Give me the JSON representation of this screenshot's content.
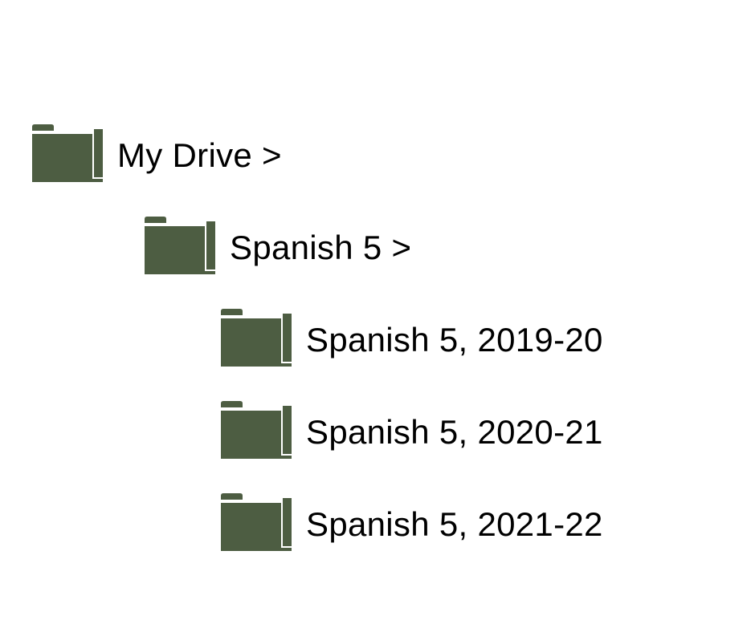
{
  "folder_color": "#4d5d42",
  "tree": {
    "root": {
      "label": "My Drive >"
    },
    "child": {
      "label": "Spanish 5 >"
    },
    "leaves": [
      {
        "label": "Spanish 5, 2019-20"
      },
      {
        "label": "Spanish 5, 2020-21"
      },
      {
        "label": "Spanish 5, 2021-22"
      }
    ]
  }
}
